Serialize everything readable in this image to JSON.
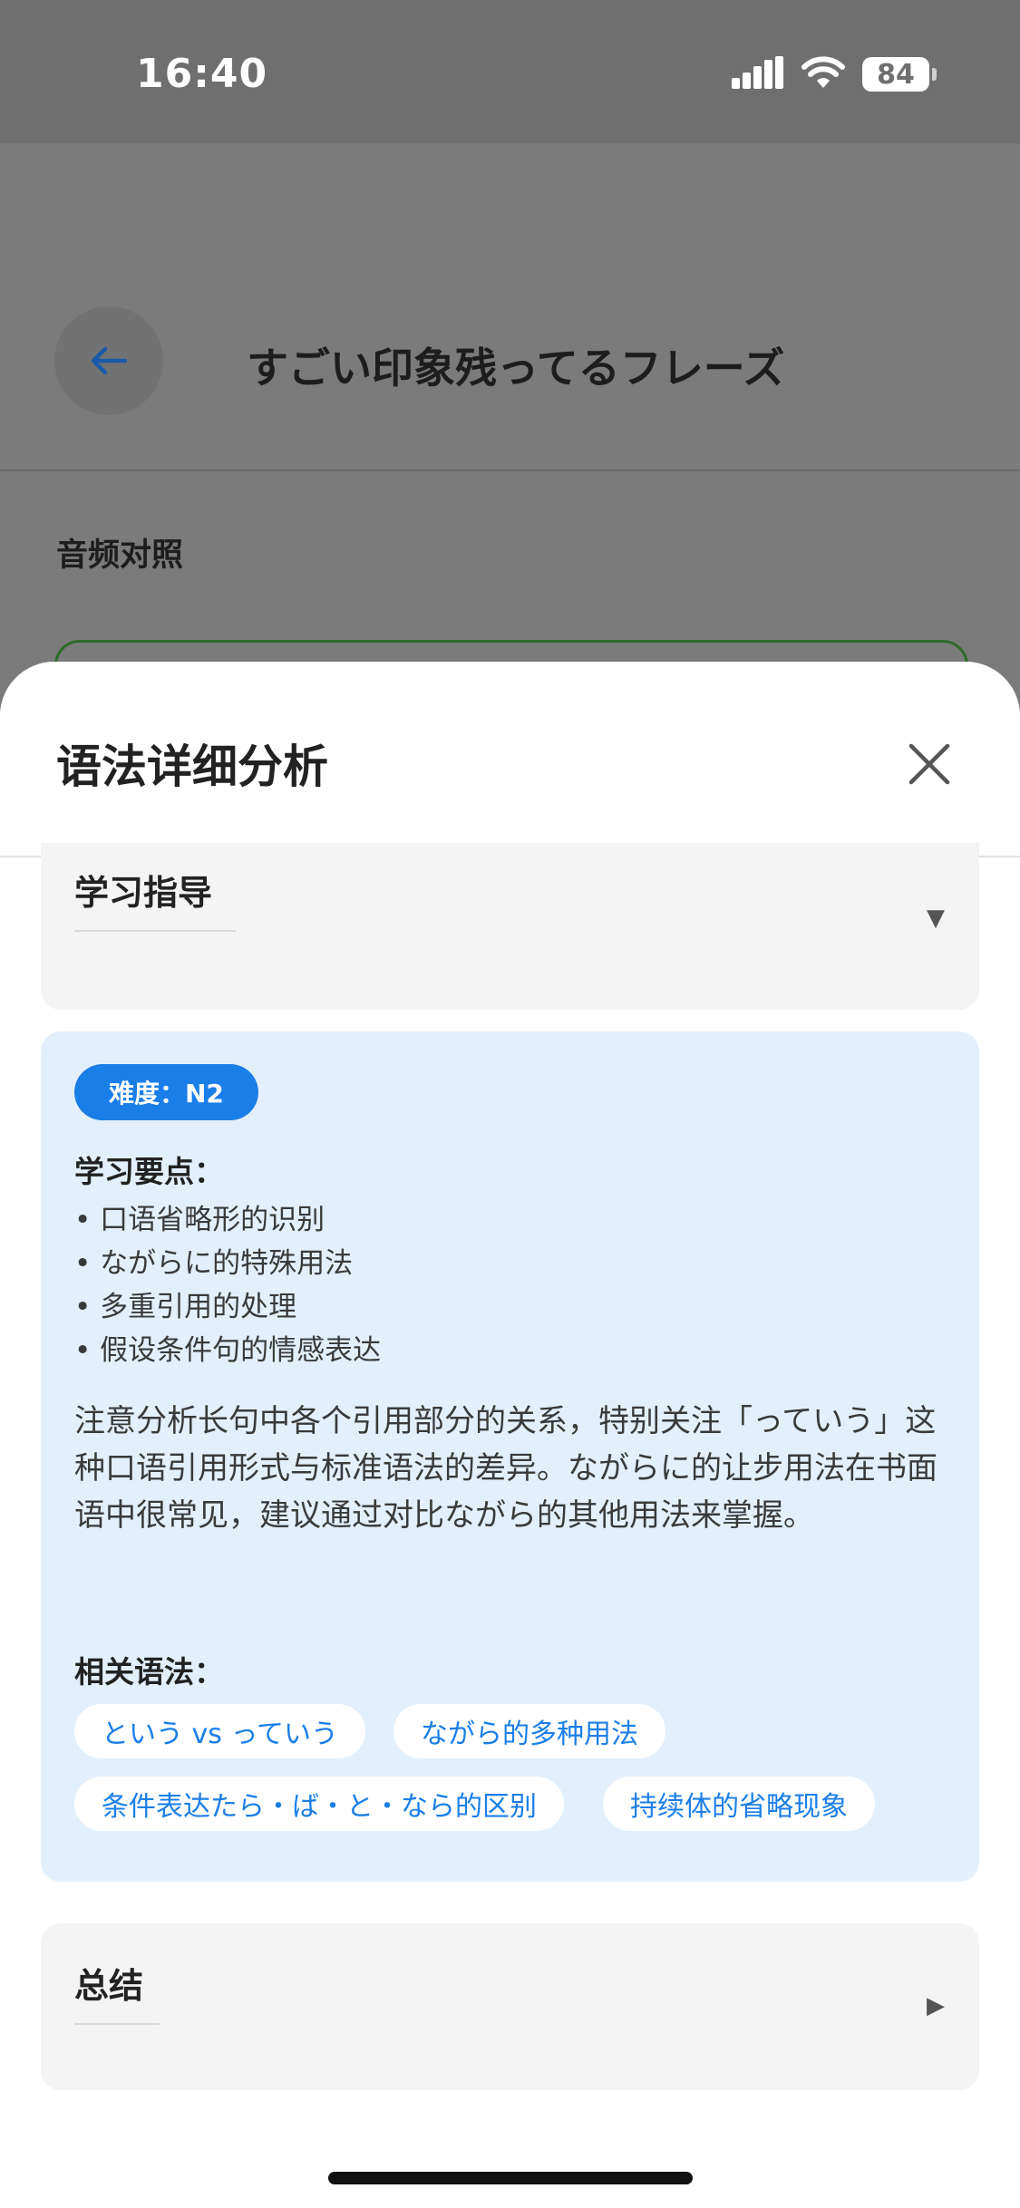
{
  "status_bar": {
    "time": "16:40",
    "battery": "84"
  },
  "background_page": {
    "title": "すごい印象残ってるフレーズ",
    "audio_section_label": "音频对照"
  },
  "sheet": {
    "title": "语法详细分析",
    "sections": {
      "study_guide": {
        "title": "学习指导",
        "chevron": "▼"
      },
      "summary": {
        "title": "总结",
        "chevron": "▶"
      }
    },
    "detail": {
      "level_badge": "难度：N2",
      "points_heading": "学习要点：",
      "points": [
        "• 口语省略形的识别",
        "• ながらに的特殊用法",
        "• 多重引用的处理",
        "• 假设条件句的情感表达"
      ],
      "advice": "注意分析长句中各个引用部分的关系，特别关注「っていう」这种口语引用形式与标准语法的差异。ながらに的让步用法在书面语中很常见，建议通过对比ながら的其他用法来掌握。",
      "related_heading": "相关语法：",
      "related_chips": [
        "という vs っていう",
        "ながら的多种用法",
        "条件表达たら・ば・と・なら的区别",
        "持续体的省略现象"
      ]
    }
  },
  "colors": {
    "accent_blue": "#1a7ee8",
    "detail_background": "#e3f0fb",
    "section_background": "#f4f4f4",
    "overlay_gray": "#7b7b7b"
  },
  "icons": [
    "signal-icon",
    "wifi-icon",
    "battery-icon",
    "back-arrow-icon",
    "close-icon"
  ]
}
